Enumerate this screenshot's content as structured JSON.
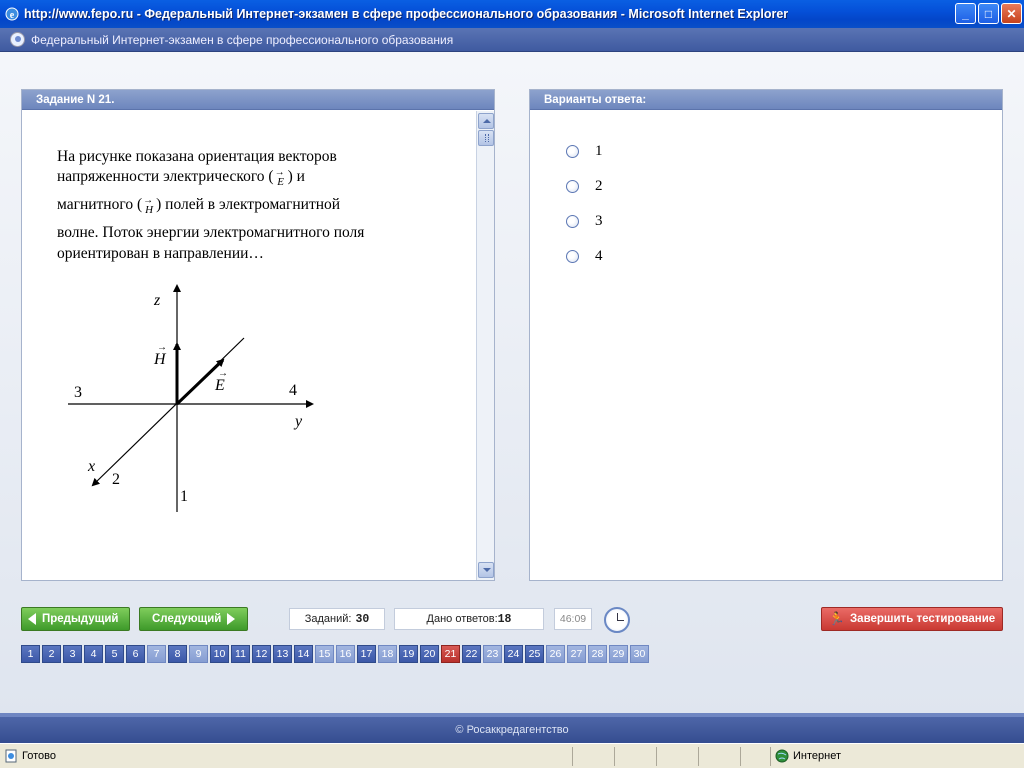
{
  "window": {
    "title": "http://www.fepo.ru - Федеральный Интернет-экзамен в сфере профессионального образования - Microsoft Internet Explorer",
    "minimize": "_",
    "maximize": "□",
    "close": "✕"
  },
  "app": {
    "header_title": "Федеральный Интернет-экзамен в сфере профессионального образования",
    "footer_text": "© Росаккредагентство"
  },
  "task": {
    "panel_title": "Задание N 21.",
    "question": {
      "line1": "На рисунке показана ориентация векторов",
      "line2_a": "напряженности электрического (",
      "line2_b": ") и",
      "line3_a": "магнитного (",
      "line3_b": ") полей в электромагнитной",
      "line4": "волне. Поток энергии электромагнитного поля",
      "line5": "ориентирован в направлении…",
      "vector_e": "E",
      "vector_h": "H",
      "arrow": "→"
    },
    "figure": {
      "axis_z": "z",
      "axis_y": "y",
      "axis_x": "x",
      "vec_h": "H",
      "vec_e": "E",
      "dir1": "1",
      "dir2": "2",
      "dir3": "3",
      "dir4": "4"
    }
  },
  "answers": {
    "panel_title": "Варианты ответа:",
    "options": [
      "1",
      "2",
      "3",
      "4"
    ]
  },
  "nav": {
    "prev_label": "Предыдущий",
    "next_label": "Следующий",
    "tasks_label": "Заданий:",
    "tasks_count": "30",
    "answered_label": "Дано ответов:",
    "answered_count": "18",
    "timer": "46:09",
    "finish_label": "Завершить тестирование"
  },
  "pages": {
    "items": [
      "1",
      "2",
      "3",
      "4",
      "5",
      "6",
      "7",
      "8",
      "9",
      "10",
      "11",
      "12",
      "13",
      "14",
      "15",
      "16",
      "17",
      "18",
      "19",
      "20",
      "21",
      "22",
      "23",
      "24",
      "25",
      "26",
      "27",
      "28",
      "29",
      "30"
    ],
    "current": "21",
    "colors": {
      "answered": "#3c58a8",
      "unanswered": "#869dd2",
      "current": "#b8302c"
    }
  },
  "status": {
    "left": "Готово",
    "zone": "Интернет"
  }
}
